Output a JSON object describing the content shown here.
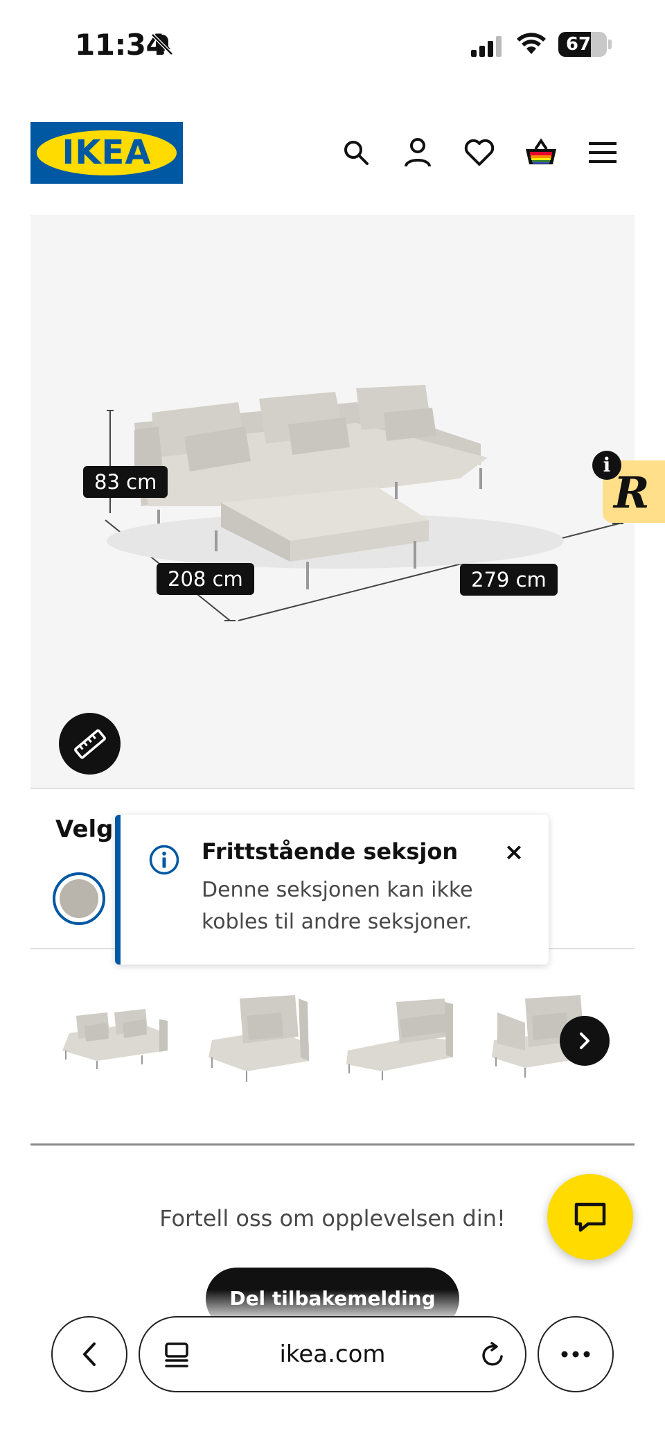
{
  "status_bar": {
    "time": "11:34",
    "battery": "67",
    "battery_level": 0.67
  },
  "header": {
    "logo_text": "IKEA",
    "icons": [
      "search-icon",
      "account-icon",
      "heart-icon",
      "basket-icon",
      "menu-icon"
    ]
  },
  "product_image": {
    "dimensions": {
      "height": "83 cm",
      "depth": "208 cm",
      "width": "279 cm"
    }
  },
  "options": {
    "heading": "Velg"
  },
  "tooltip": {
    "title": "Frittstående seksjon",
    "body": "Denne seksjonen kan ikke kobles til andre seksjoner.",
    "close": "×"
  },
  "thumbnails": [
    "two-seat-section",
    "one-seat-section",
    "chaise-longue-section",
    "corner-section"
  ],
  "feedback": {
    "prompt": "Fortell oss om opplevelsen din!",
    "button": "Del tilbakemelding"
  },
  "browser": {
    "url": "ikea.com"
  },
  "colors": {
    "ikea_blue": "#0058a3",
    "ikea_yellow": "#ffdb00",
    "sofa_beige": "#d9d6cf"
  }
}
